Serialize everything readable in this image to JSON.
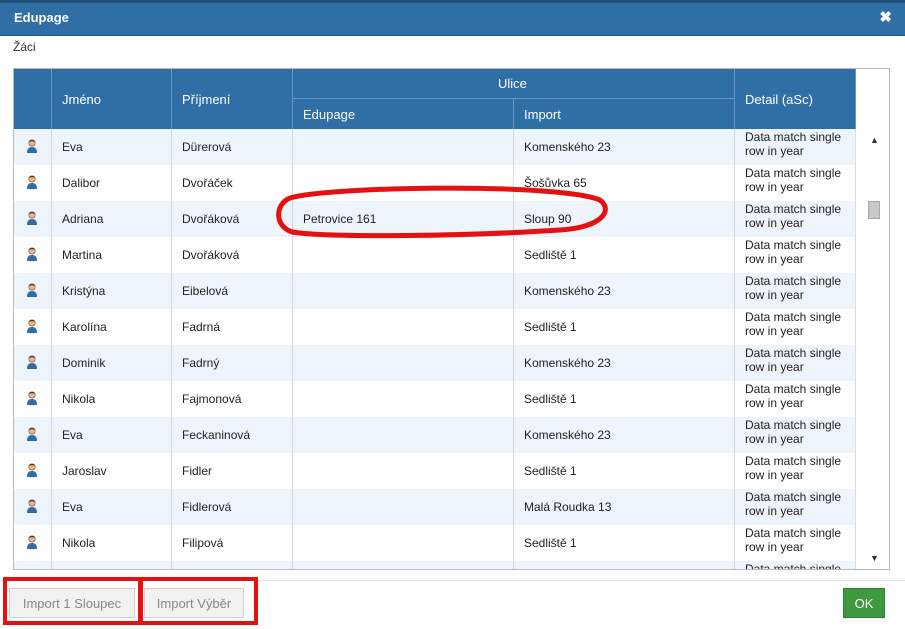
{
  "window": {
    "title": "Edupage",
    "close_icon": "close-icon"
  },
  "section_label": "Žáci",
  "table": {
    "headers": {
      "jmeno": "Jméno",
      "prijmeni": "Příjmení",
      "ulice": "Ulice",
      "edupage": "Edupage",
      "import": "Import",
      "detail": "Detail (aSc)"
    },
    "rows": [
      {
        "jmeno": "Eva",
        "prijmeni": "Dürerová",
        "edupage": "",
        "import": "Komenského 23",
        "detail": "Data match single row in year"
      },
      {
        "jmeno": "Dalibor",
        "prijmeni": "Dvořáček",
        "edupage": "",
        "import": "Šošůvka 65",
        "detail": "Data match single row in year"
      },
      {
        "jmeno": "Adriana",
        "prijmeni": "Dvořáková",
        "edupage": "Petrovice 161",
        "import": "Sloup 90",
        "detail": "Data match single row in year"
      },
      {
        "jmeno": "Martina",
        "prijmeni": "Dvořáková",
        "edupage": "",
        "import": "Sedliště 1",
        "detail": "Data match single row in year"
      },
      {
        "jmeno": "Kristýna",
        "prijmeni": "Eibelová",
        "edupage": "",
        "import": "Komenského 23",
        "detail": "Data match single row in year"
      },
      {
        "jmeno": "Karolína",
        "prijmeni": "Fadrná",
        "edupage": "",
        "import": "Sedliště 1",
        "detail": "Data match single row in year"
      },
      {
        "jmeno": "Dominik",
        "prijmeni": "Fadrný",
        "edupage": "",
        "import": "Komenského 23",
        "detail": "Data match single row in year"
      },
      {
        "jmeno": "Nikola",
        "prijmeni": "Fajmonová",
        "edupage": "",
        "import": "Sedliště 1",
        "detail": "Data match single row in year"
      },
      {
        "jmeno": "Eva",
        "prijmeni": "Feckaninová",
        "edupage": "",
        "import": "Komenského 23",
        "detail": "Data match single row in year"
      },
      {
        "jmeno": "Jaroslav",
        "prijmeni": "Fidler",
        "edupage": "",
        "import": "Sedliště 1",
        "detail": "Data match single row in year"
      },
      {
        "jmeno": "Eva",
        "prijmeni": "Fidlerová",
        "edupage": "",
        "import": "Malá Roudka 13",
        "detail": "Data match single row in year"
      },
      {
        "jmeno": "Nikola",
        "prijmeni": "Filipová",
        "edupage": "",
        "import": "Sedliště 1",
        "detail": "Data match single row in year"
      },
      {
        "jmeno": "",
        "prijmeni": "",
        "edupage": "",
        "import": "",
        "detail": "Data match single row in year"
      }
    ],
    "row_icon": "user-icon"
  },
  "buttons": {
    "import_sloupec": "Import 1 Sloupec",
    "import_vyber": "Import Výběr",
    "ok": "OK"
  },
  "colors": {
    "header_bg": "#2f6fa5",
    "alt_row": "#eef4fb",
    "ok_button": "#3f9a3f",
    "annotation": "#e51010"
  }
}
